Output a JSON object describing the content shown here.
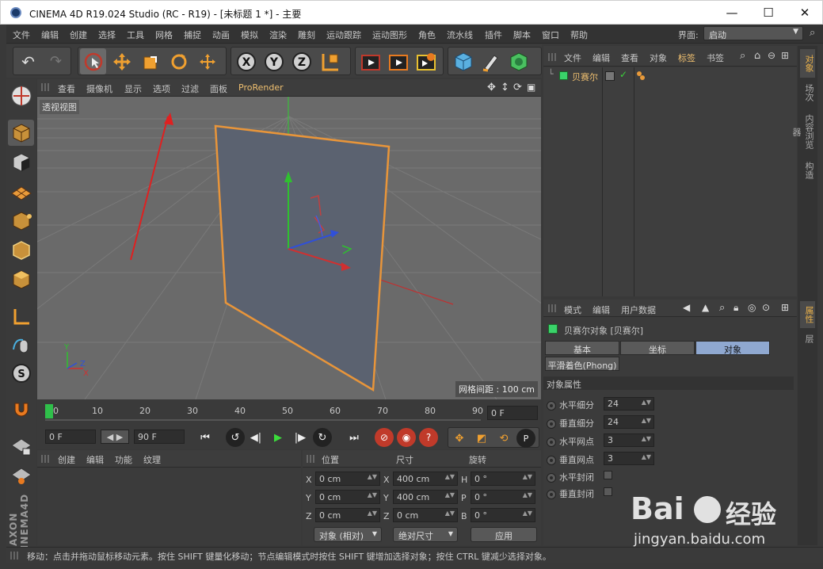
{
  "window": {
    "title": "CINEMA 4D R19.024 Studio (RC - R19) - [未标题 1 *] - 主要",
    "minimize": "—",
    "maximize": "☐",
    "close": "✕"
  },
  "menubar": {
    "items": [
      "文件",
      "编辑",
      "创建",
      "选择",
      "工具",
      "网格",
      "捕捉",
      "动画",
      "模拟",
      "渲染",
      "雕刻",
      "运动跟踪",
      "运动图形",
      "角色",
      "流水线",
      "插件",
      "脚本",
      "窗口",
      "帮助"
    ],
    "layout_label": "界面:",
    "layout_value": "启动"
  },
  "viewport": {
    "menu": [
      "查看",
      "摄像机",
      "显示",
      "选项",
      "过滤",
      "面板",
      "ProRender"
    ],
    "label": "透视视图",
    "grid_info": "网格间距 : 100 cm"
  },
  "timeline": {
    "ticks": [
      "0",
      "10",
      "20",
      "30",
      "40",
      "50",
      "60",
      "70",
      "80",
      "90"
    ],
    "current_frame": "0 F"
  },
  "transport": {
    "start": "0 F",
    "end": "90 F",
    "step": "◀ ▶"
  },
  "material_panel": {
    "menu": [
      "创建",
      "编辑",
      "功能",
      "纹理"
    ]
  },
  "coordinates": {
    "headers": [
      "位置",
      "尺寸",
      "旋转"
    ],
    "rows": [
      {
        "axis": "X",
        "pos": "0 cm",
        "size_axis": "X",
        "size": "400 cm",
        "rot_axis": "H",
        "rot": "0 °"
      },
      {
        "axis": "Y",
        "pos": "0 cm",
        "size_axis": "Y",
        "size": "400 cm",
        "rot_axis": "P",
        "rot": "0 °"
      },
      {
        "axis": "Z",
        "pos": "0 cm",
        "size_axis": "Z",
        "size": "0 cm",
        "rot_axis": "B",
        "rot": "0 °"
      }
    ],
    "mode": "对象 (相对)",
    "size_mode": "绝对尺寸",
    "apply": "应用"
  },
  "object_manager": {
    "menu": [
      "文件",
      "编辑",
      "查看",
      "对象",
      "标签",
      "书签"
    ],
    "objects": [
      {
        "name": "贝赛尔"
      }
    ]
  },
  "attributes": {
    "menu": [
      "模式",
      "编辑",
      "用户数据"
    ],
    "object_title": "贝赛尔对象 [贝赛尔]",
    "tabs": [
      "基本",
      "坐标",
      "对象"
    ],
    "active_tab": "对象",
    "extra_tab": "平滑着色(Phong)",
    "section": "对象属性",
    "params": [
      {
        "label": "水平细分",
        "value": "24"
      },
      {
        "label": "垂直细分",
        "value": "24"
      },
      {
        "label": "水平网点",
        "value": "3"
      },
      {
        "label": "垂直网点",
        "value": "3"
      }
    ],
    "checks": [
      {
        "label": "水平封闭"
      },
      {
        "label": "垂直封闭"
      }
    ]
  },
  "right_tabs": [
    "对象",
    "场次",
    "内容浏览器",
    "构造",
    "属性",
    "层"
  ],
  "status": "移动：点击并拖动鼠标移动元素。按住 SHIFT 键量化移动；节点编辑模式时按住 SHIFT 键增加选择对象；按住 CTRL 键减少选择对象。",
  "watermark": {
    "brand": "Bai",
    "brand2": "经验",
    "url": "jingyan.baidu.com"
  },
  "colors": {
    "accent": "#e8b04a",
    "active_tab": "#8fa8d0",
    "plane_outline": "#e89a3a"
  }
}
